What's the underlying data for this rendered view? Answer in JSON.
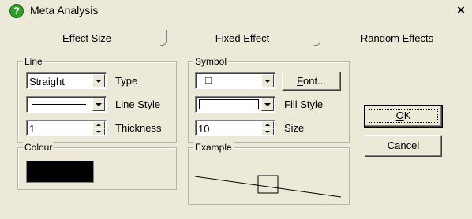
{
  "window": {
    "title": "Meta Analysis",
    "close_glyph": "×",
    "icon": "help-icon"
  },
  "tabs": [
    {
      "label": "Effect Size"
    },
    {
      "label": "Fixed Effect"
    },
    {
      "label": "Random Effects"
    }
  ],
  "line": {
    "legend": "Line",
    "type": {
      "value": "Straight",
      "label": "Type"
    },
    "style": {
      "label": "Line Style"
    },
    "thickness": {
      "value": "1",
      "label": "Thickness"
    }
  },
  "symbol": {
    "legend": "Symbol",
    "shape_glyph": "□",
    "font_button": "Font...",
    "font_button_underline": "F",
    "font_button_rest": "ont...",
    "fill_style": {
      "label": "Fill Style"
    },
    "size": {
      "value": "10",
      "label": "Size"
    }
  },
  "colour": {
    "legend": "Colour",
    "value": "#000000"
  },
  "example": {
    "legend": "Example"
  },
  "buttons": {
    "ok": {
      "underline": "O",
      "rest": "K"
    },
    "cancel": {
      "underline": "C",
      "rest": "ancel"
    }
  }
}
